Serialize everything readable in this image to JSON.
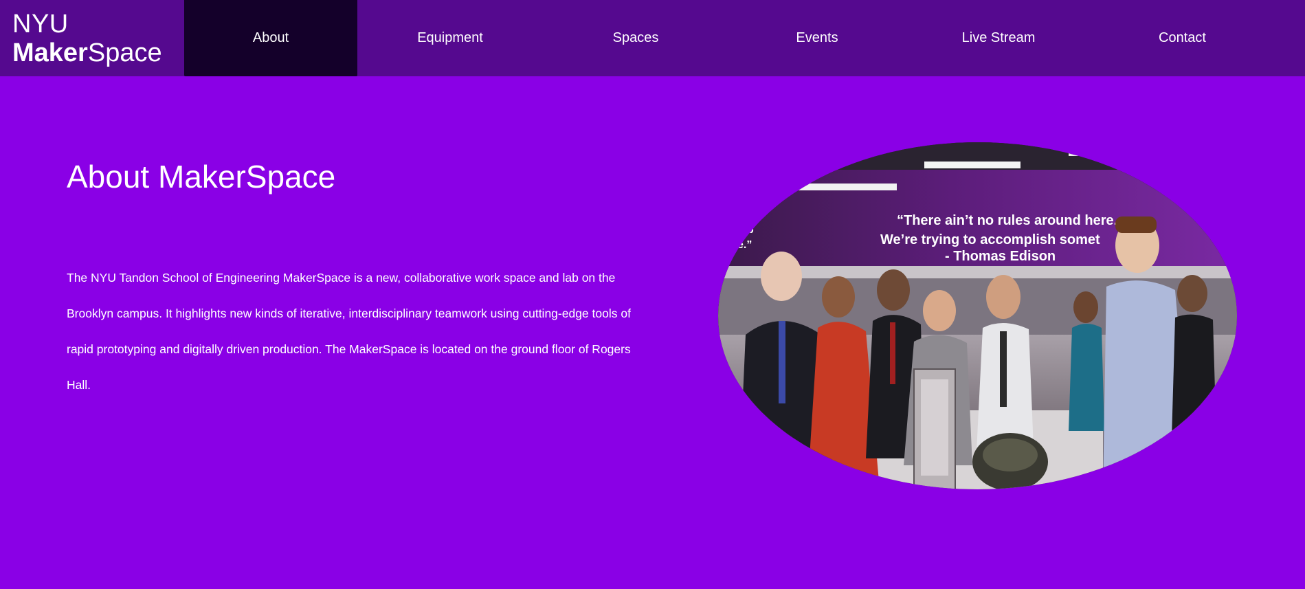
{
  "brand": {
    "line1": "NYU",
    "line2_bold": "Maker",
    "line2_light": "Space"
  },
  "nav": {
    "items": [
      {
        "label": "About",
        "active": true
      },
      {
        "label": "Equipment",
        "active": false
      },
      {
        "label": "Spaces",
        "active": false
      },
      {
        "label": "Events",
        "active": false
      },
      {
        "label": "Live Stream",
        "active": false
      },
      {
        "label": "Contact",
        "active": false
      }
    ]
  },
  "main": {
    "title": "About MakerSpace",
    "body": "The NYU Tandon School of Engineering MakerSpace is a new, collaborative work space and lab on the Brooklyn campus. It highlights new kinds of iterative, interdisciplinary teamwork using cutting-edge tools of rapid prototyping and digitally driven production. The MakerSpace is located on the ground floor of Rogers Hall."
  },
  "photo": {
    "quote_line1": "“There ain’t no rules around here.",
    "quote_line2": "We’re trying to accomplish somet",
    "quote_line2_tail": "”",
    "quote_line3": "- Thomas Edison",
    "left_fragment1": "b",
    "left_fragment2": "e.”"
  },
  "colors": {
    "page_bg": "#8a00e6",
    "nav_bg": "#55098f",
    "nav_active_bg": "#14002a",
    "text": "#ffffff"
  }
}
